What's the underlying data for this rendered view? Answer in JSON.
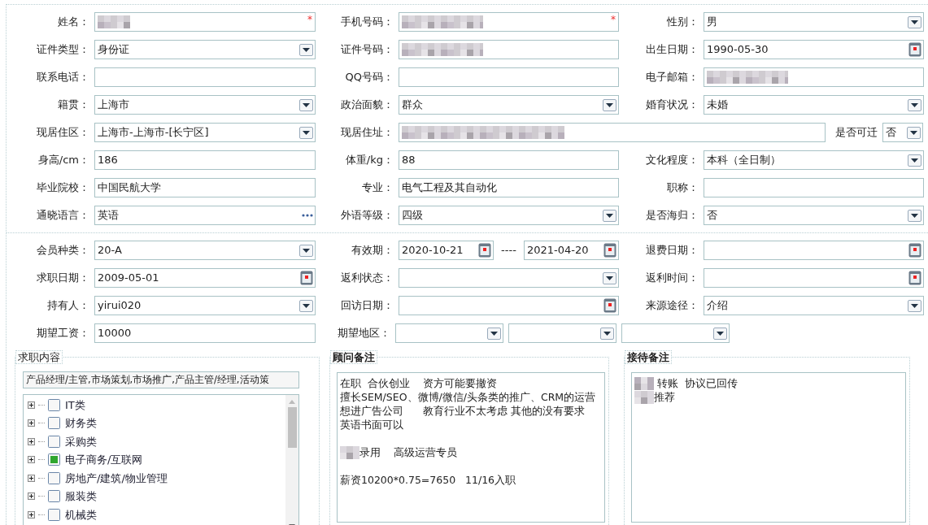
{
  "section_basic": {
    "rows": [
      {
        "fields": [
          {
            "label": "姓名：",
            "kind": "text",
            "redacted": true,
            "required_mark": "*"
          },
          {
            "label": "手机号码：",
            "kind": "text",
            "redacted": true,
            "required_mark": "*"
          },
          {
            "label": "性别：",
            "kind": "select",
            "value": "男"
          }
        ]
      },
      {
        "fields": [
          {
            "label": "证件类型：",
            "kind": "select",
            "value": "身份证"
          },
          {
            "label": "证件号码：",
            "kind": "text",
            "redacted": true
          },
          {
            "label": "出生日期：",
            "kind": "date",
            "value": "1990-05-30"
          }
        ]
      },
      {
        "fields": [
          {
            "label": "联系电话：",
            "kind": "text"
          },
          {
            "label": "QQ号码：",
            "kind": "text"
          },
          {
            "label": "电子邮箱：",
            "kind": "text",
            "redacted": true
          }
        ]
      },
      {
        "fields": [
          {
            "label": "籍贯：",
            "kind": "select",
            "value": "上海市"
          },
          {
            "label": "政治面貌：",
            "kind": "select",
            "value": "群众"
          },
          {
            "label": "婚育状况：",
            "kind": "select",
            "value": "未婚"
          }
        ]
      },
      {
        "fields": [
          {
            "label": "现居住区：",
            "kind": "select",
            "value": "上海市-上海市-[长宁区]"
          },
          {
            "label": "现居住址：",
            "kind": "text",
            "redacted": true
          },
          {
            "label": "是否可迁",
            "kind": "select",
            "value": "否"
          }
        ]
      },
      {
        "fields": [
          {
            "label": "身高/cm：",
            "kind": "text",
            "value": "186"
          },
          {
            "label": "体重/kg：",
            "kind": "text",
            "value": "88"
          },
          {
            "label": "文化程度：",
            "kind": "select",
            "value": "本科（全日制）"
          }
        ]
      },
      {
        "fields": [
          {
            "label": "毕业院校：",
            "kind": "text",
            "value": "中国民航大学"
          },
          {
            "label": "专业：",
            "kind": "text",
            "value": "电气工程及其自动化"
          },
          {
            "label": "职称：",
            "kind": "text"
          }
        ]
      },
      {
        "fields": [
          {
            "label": "通晓语言：",
            "kind": "picker",
            "value": "英语"
          },
          {
            "label": "外语等级：",
            "kind": "select",
            "value": "四级"
          },
          {
            "label": "是否海归：",
            "kind": "select",
            "value": "否"
          }
        ]
      }
    ]
  },
  "section_member": {
    "rows": [
      {
        "fields": [
          {
            "label": "会员种类：",
            "kind": "select",
            "value": "20-A"
          },
          {
            "label": "有效期：",
            "kind": "range",
            "parts": [
              {
                "kind": "date",
                "value": "2020-10-21"
              },
              {
                "kind": "separator",
                "text": "----"
              },
              {
                "kind": "date",
                "value": "2021-04-20"
              }
            ]
          },
          {
            "label": "退费日期：",
            "kind": "date"
          }
        ]
      },
      {
        "fields": [
          {
            "label": "求职日期：",
            "kind": "date",
            "value": "2009-05-01"
          },
          {
            "label": "返利状态：",
            "kind": "select"
          },
          {
            "label": "返利时间：",
            "kind": "date"
          }
        ]
      },
      {
        "fields": [
          {
            "label": "持有人：",
            "kind": "select",
            "value": "yirui020"
          },
          {
            "label": "回访日期：",
            "kind": "date"
          },
          {
            "label": "来源途径：",
            "kind": "select",
            "value": "介绍"
          }
        ]
      },
      {
        "fields": [
          {
            "label": "期望工资：",
            "kind": "text",
            "value": "10000"
          },
          {
            "label": "期望地区：",
            "kind": "range",
            "parts": [
              {
                "kind": "select"
              },
              {
                "kind": "select"
              },
              {
                "kind": "select"
              }
            ]
          }
        ]
      }
    ]
  },
  "job_panel": {
    "legend": "求职内容",
    "selection": "产品经理/主管,市场策划,市场推广,产品主管/经理,活动策",
    "tree": [
      {
        "label": "IT类",
        "expanded": false,
        "checked": false
      },
      {
        "label": "财务类",
        "expanded": false,
        "checked": false
      },
      {
        "label": "采购类",
        "expanded": false,
        "checked": false
      },
      {
        "label": "电子商务/互联网",
        "expanded": false,
        "checked": true
      },
      {
        "label": "房地产/建筑/物业管理",
        "expanded": false,
        "checked": false
      },
      {
        "label": "服装类",
        "expanded": false,
        "checked": false
      },
      {
        "label": "机械类",
        "expanded": false,
        "checked": false
      }
    ]
  },
  "consultant_notes": {
    "legend": "顾问备注",
    "paragraphs": [
      {
        "lines": [
          {
            "text": "在职  合伙创业    资方可能要撤资"
          },
          {
            "text": "擅长SEM/SEO、微博/微信/头条类的推广、CRM的运营"
          },
          {
            "text": "想进广告公司      教育行业不太考虑 其他的没有要求"
          },
          {
            "text": "英语书面可以"
          }
        ]
      },
      {
        "lines": [
          {
            "text": "录用    高级运营专员",
            "redacted": true
          }
        ]
      },
      {
        "lines": [
          {
            "text": "薪资10200*0.75=7650   11/16入职"
          }
        ]
      }
    ]
  },
  "reception_notes": {
    "legend": "接待备注",
    "paragraphs": [
      {
        "lines": [
          {
            "text": " 转账  协议已回传",
            "redacted": true
          },
          {
            "text": "推荐",
            "redacted": true
          }
        ]
      }
    ]
  }
}
